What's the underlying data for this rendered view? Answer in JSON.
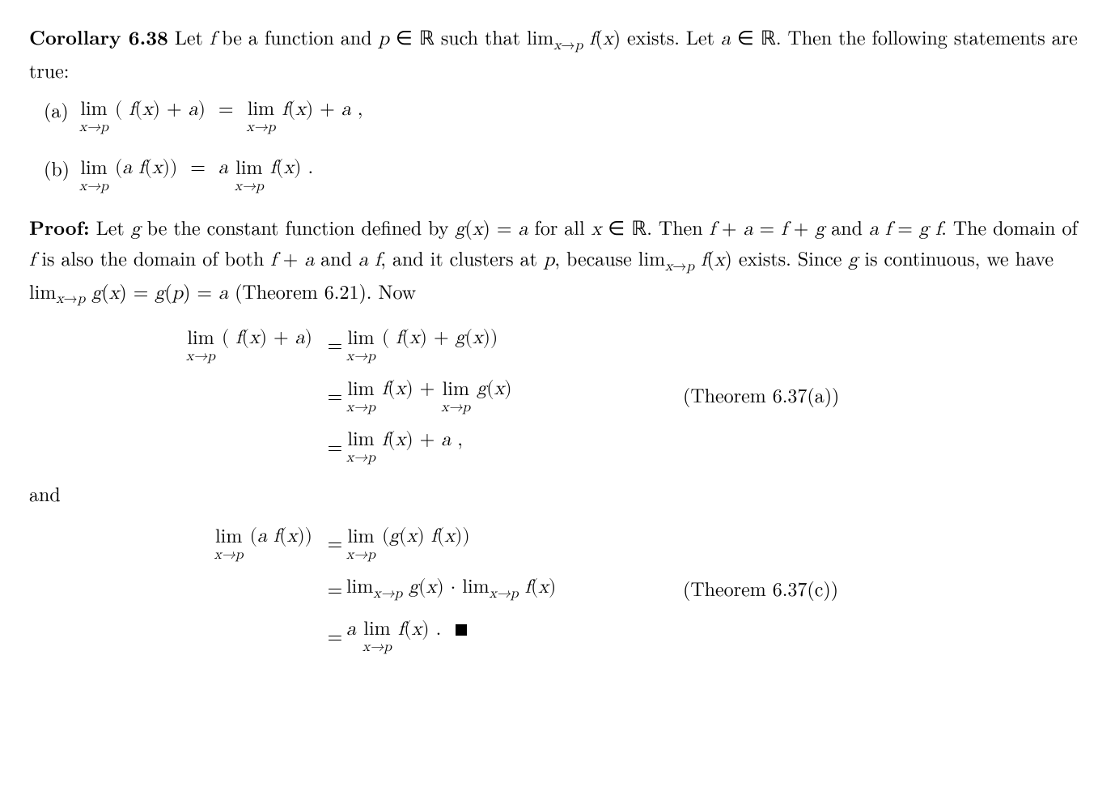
{
  "corollary": {
    "label": "Corollary 6.38",
    "intro": "Let f be a function and p ∈ ℝ such that lim_{x→p} f(x) exists. Let a ∈ ℝ. Then the following statements are true:"
  },
  "items": {
    "a": {
      "label": "(a)",
      "stmt": "lim_{x→p} (f(x) + a) = lim_{x→p} f(x) + a ,"
    },
    "b": {
      "label": "(b)",
      "stmt": "lim_{x→p} (a f(x)) = a lim_{x→p} f(x) ."
    }
  },
  "proof": {
    "label": "Proof:",
    "text": "Let g be the constant function defined by g(x) = a for all x ∈ ℝ. Then f + a = f + g and a f = g f. The domain of f is also the domain of both f + a and a f, and it clusters at p, because lim_{x→p} f(x) exists. Since g is continuous, we have lim_{x→p} g(x) = g(p) = a (Theorem 6.21). Now"
  },
  "deriv1": {
    "lhs": "lim_{x→p} (f(x) + a)",
    "r1": "lim_{x→p} (f(x) + g(x))",
    "r2": "lim_{x→p} f(x) + lim_{x→p} g(x)",
    "r2note": "(Theorem 6.37(a))",
    "r3": "lim_{x→p} f(x) + a ,"
  },
  "and": "and",
  "deriv2": {
    "lhs": "lim_{x→p} (a f(x))",
    "r1": "lim_{x→p} (g(x) f(x))",
    "r2": "lim_{x→p} g(x) · lim_{x→p} f(x)",
    "r2note": "(Theorem 6.37(c))",
    "r3": "a lim_{x→p} f(x) ."
  }
}
